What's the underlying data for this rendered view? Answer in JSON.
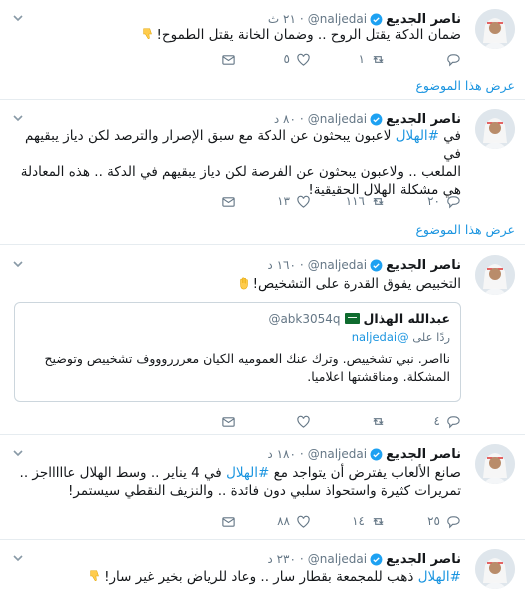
{
  "tweets": [
    {
      "name": "ناصر الجديع",
      "handle": "@naljedai",
      "time": "٢١ ث",
      "text": "ضمان الدكة يقتل الروح .. وضمان الخانة يقتل الطموح!",
      "emoji_icon": "thumbs-down-icon",
      "actions": {
        "replies": "",
        "retweets": "١",
        "likes": "٥"
      },
      "thread_label": "عرض هذا الموضوع"
    },
    {
      "name": "ناصر الجديع",
      "handle": "@naljedai",
      "time": "٨٠ د",
      "text_lines": [
        "في #الهلال لاعبون يبحثون عن الدكة مع سبق الإصرار والترصد لكن دياز يبقيهم في",
        "الملعب .. ولاعبون يبحثون عن الفرصة لكن دياز يبقيهم في الدكة .. هذه المعادلة",
        "هي مشكلة الهلال الحقيقية!"
      ],
      "hashtag": "#الهلال",
      "actions": {
        "replies": "٢٠",
        "retweets": "١١٦",
        "likes": "١٣"
      },
      "thread_label": "عرض هذا الموضوع"
    },
    {
      "name": "ناصر الجديع",
      "handle": "@naljedai",
      "time": "١٦٠ د",
      "text": "التخبيص يفوق القدرة على التشخيص!",
      "emoji_icon": "raised-hand-icon",
      "quote": {
        "name": "عبدالله الهذال",
        "handle": "@abk3054q",
        "reply_prefix": "ردًا على",
        "reply_to": "@naljedai",
        "text_lines": [
          "نااصر. نبي تشخييص. وترك عنك العموميه  الكيان معررروووف  تشخييص وتوضيح",
          "المشكلة. ومناقشتها اعلاميا."
        ]
      },
      "actions": {
        "replies": "٤",
        "retweets": "",
        "likes": ""
      }
    },
    {
      "name": "ناصر الجديع",
      "handle": "@naljedai",
      "time": "١٨٠ د",
      "text_lines": [
        "صانع الألعاب يفترض أن يتواجد مع #الهلال في 4 يناير .. وسط الهلال عاااااجز ..",
        "تمريرات كثيرة واستحواذ سلبي دون فائدة .. والنزيف النقطي سيستمر!"
      ],
      "hashtag": "#الهلال",
      "actions": {
        "replies": "٢٥",
        "retweets": "١٤",
        "likes": "٨٨"
      }
    },
    {
      "name": "ناصر الجديع",
      "handle": "@naljedai",
      "time": "٢٣٠ د",
      "text": "ذهب للمجمعة بقطار سار .. وعاد للرياض بخير غير سار!",
      "hashtag": "#الهلال",
      "emoji_icon": "thumbs-down-icon"
    }
  ],
  "colors": {
    "accent": "#1b95e0",
    "muted": "#657786",
    "border": "#e6ecf0",
    "emoji": "#ffcc4d"
  }
}
